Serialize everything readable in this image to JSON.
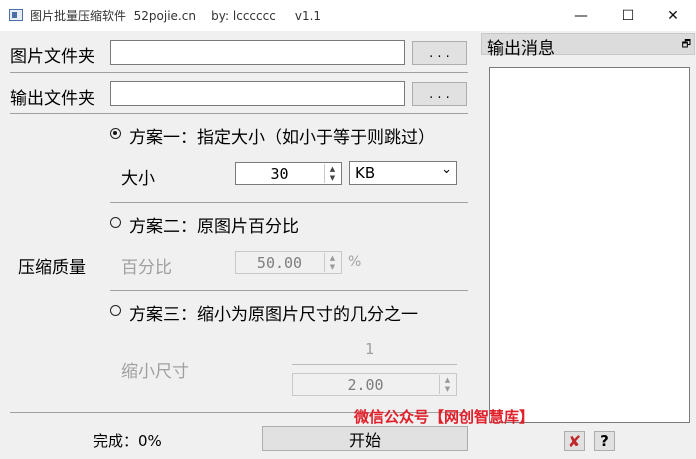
{
  "window": {
    "title": "图片批量压缩软件  52pojie.cn    by: lcccccc     v1.1",
    "controls": {
      "minimize": "—",
      "maximize": "☐",
      "close": "✕"
    }
  },
  "image_folder": {
    "label": "图片文件夹",
    "value": "",
    "browse": ". . ."
  },
  "output_folder": {
    "label": "输出文件夹",
    "value": "",
    "browse": ". . ."
  },
  "compression": {
    "group_label": "压缩质量",
    "plan1": {
      "label": "方案一：指定大小（如小于等于则跳过）",
      "selected": true,
      "size_label": "大小",
      "size_value": "30",
      "unit": "KB"
    },
    "plan2": {
      "label": "方案二：原图片百分比",
      "selected": false,
      "percent_label": "百分比",
      "percent_value": "50.00",
      "percent_sign": "%"
    },
    "plan3": {
      "label": "方案三：缩小为原图片尺寸的几分之一",
      "selected": false,
      "shrink_label": "缩小尺寸",
      "numerator": "1",
      "denominator": "2.00"
    }
  },
  "output_panel": {
    "title": "输出消息",
    "restore_icon": "🗗"
  },
  "status": {
    "progress_text": "完成：0%"
  },
  "start_button": "开始",
  "watermark": "微信公众号【网创智慧库】",
  "icons": {
    "clear": "✘",
    "help": "?"
  },
  "colors": {
    "watermark": "#e0202a",
    "clear_icon": "#c0292b"
  }
}
